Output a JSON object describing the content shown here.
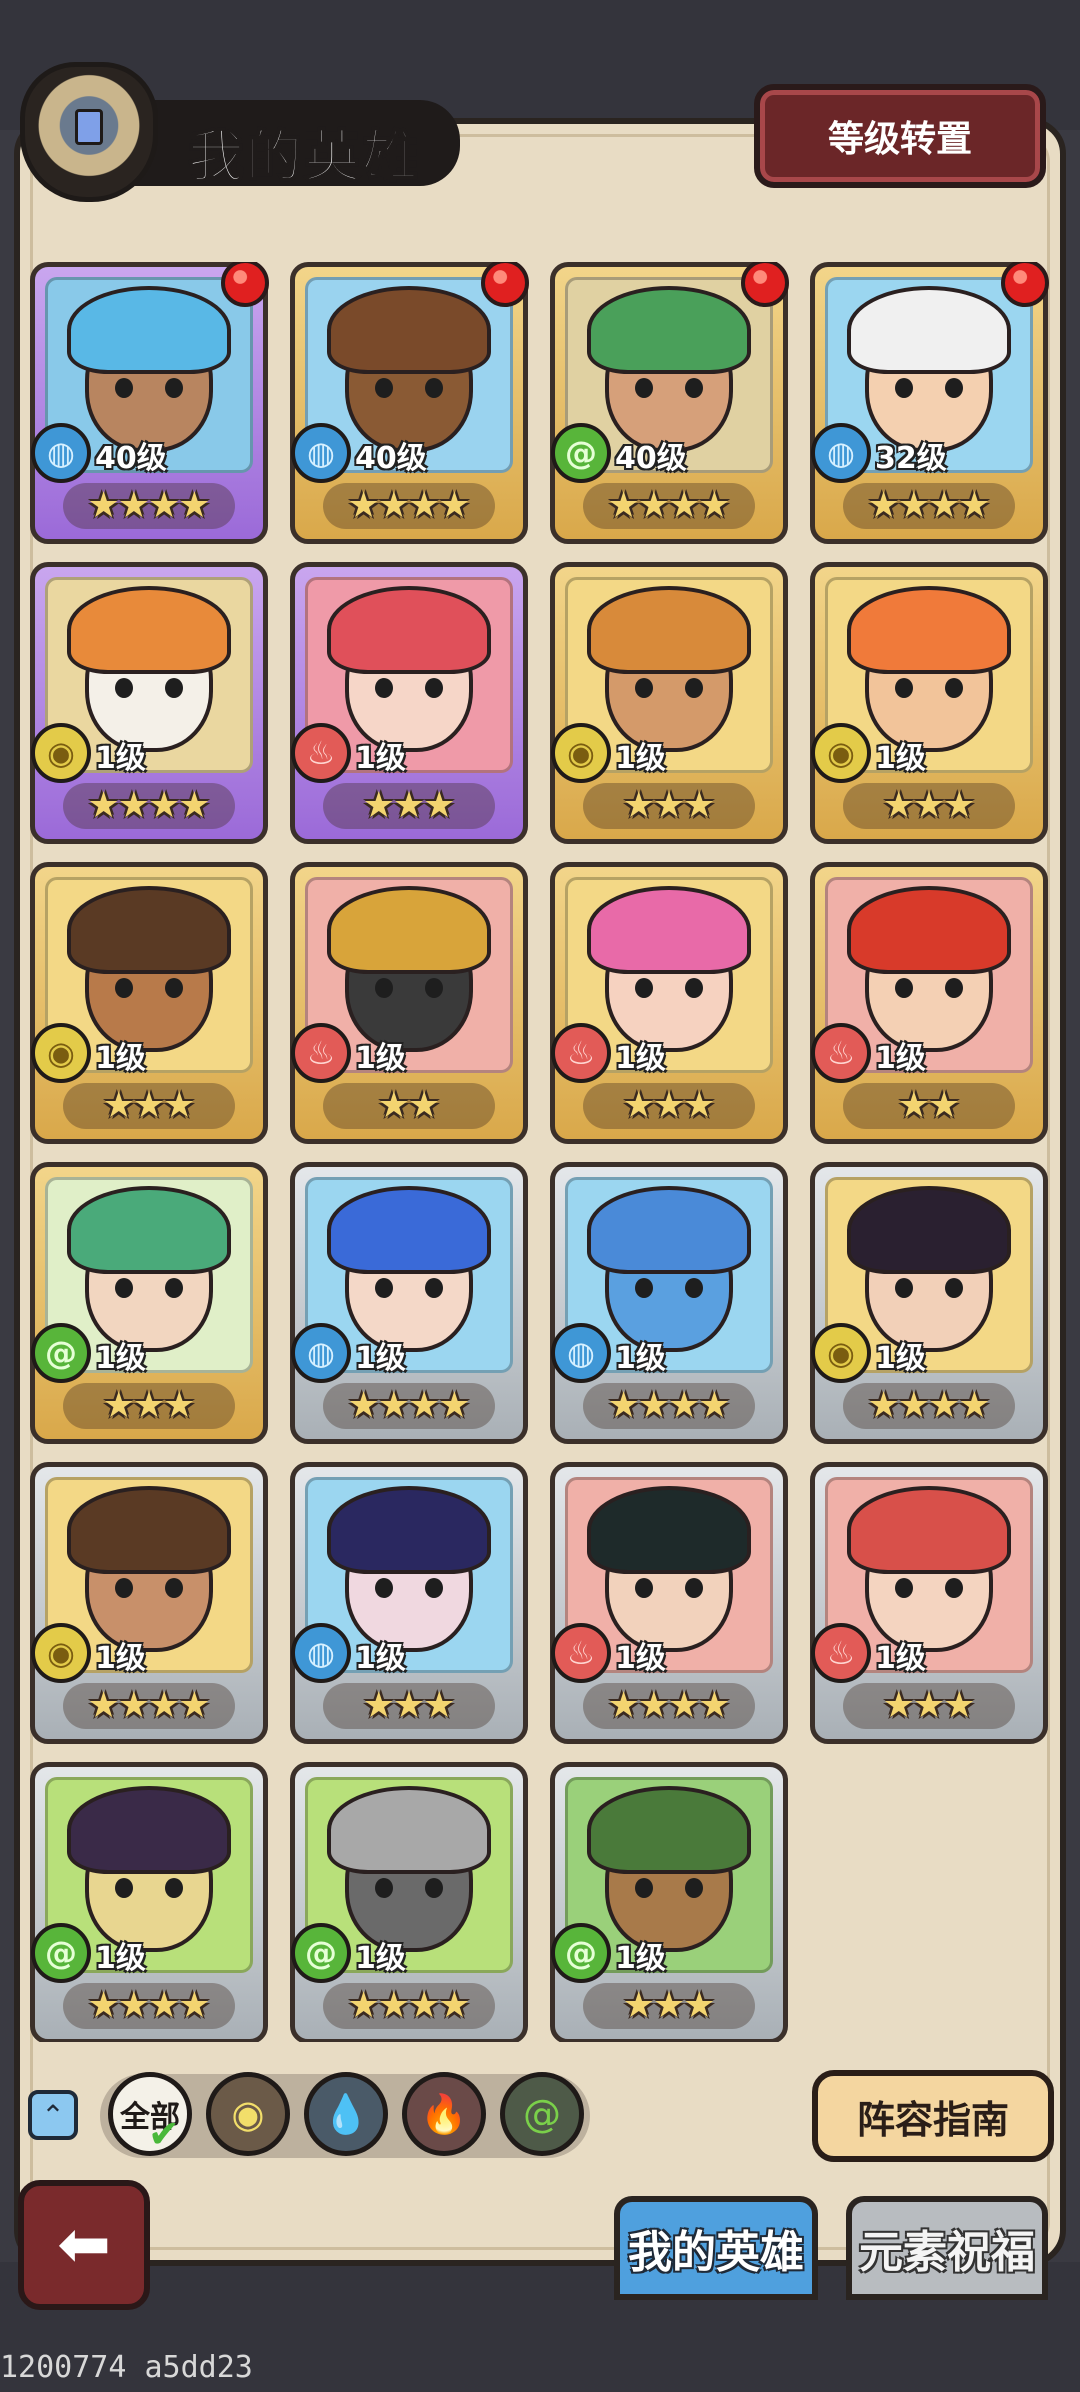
{
  "header": {
    "title": "我的英雄",
    "level_transfer_label": "等级转置"
  },
  "heroes": [
    {
      "level": "40级",
      "stars": 4,
      "element": "water",
      "frame": "purple",
      "dot": true,
      "hair": "#59b8e6",
      "skin": "#b88560",
      "bg": "#89c9e9"
    },
    {
      "level": "40级",
      "stars": 4,
      "element": "water",
      "frame": "gold",
      "dot": true,
      "hair": "#7a4a2a",
      "skin": "#8a5a34",
      "bg": "#9ad3ef"
    },
    {
      "level": "40级",
      "stars": 4,
      "element": "wind",
      "frame": "gold",
      "dot": true,
      "hair": "#4aa05a",
      "skin": "#d6a07a",
      "bg": "#e0d1a2"
    },
    {
      "level": "32级",
      "stars": 4,
      "element": "water",
      "frame": "gold",
      "dot": true,
      "hair": "#f0f0f0",
      "skin": "#f4d0b0",
      "bg": "#9bd6f0"
    },
    {
      "level": "1级",
      "stars": 4,
      "element": "earth",
      "frame": "purple",
      "dot": false,
      "hair": "#e88a3a",
      "skin": "#f4f0e8",
      "bg": "#ead7a0"
    },
    {
      "level": "1级",
      "stars": 3,
      "element": "fire",
      "frame": "purple",
      "dot": false,
      "hair": "#e0505a",
      "skin": "#f6d6c8",
      "bg": "#ef9aa8"
    },
    {
      "level": "1级",
      "stars": 3,
      "element": "earth",
      "frame": "gold",
      "dot": false,
      "hair": "#d88a3a",
      "skin": "#d49a6a",
      "bg": "#f3d886"
    },
    {
      "level": "1级",
      "stars": 3,
      "element": "earth",
      "frame": "gold",
      "dot": false,
      "hair": "#f07a3a",
      "skin": "#f2c49a",
      "bg": "#f3d886"
    },
    {
      "level": "1级",
      "stars": 3,
      "element": "earth",
      "frame": "gold",
      "dot": false,
      "hair": "#5a3a24",
      "skin": "#b87a4a",
      "bg": "#f3d886"
    },
    {
      "level": "1级",
      "stars": 2,
      "element": "fire",
      "frame": "gold",
      "dot": false,
      "hair": "#d8a43a",
      "skin": "#3a3a3a",
      "bg": "#f0b0a8"
    },
    {
      "level": "1级",
      "stars": 3,
      "element": "fire",
      "frame": "gold",
      "dot": false,
      "hair": "#e86aa8",
      "skin": "#f6d2c0",
      "bg": "#f3d886"
    },
    {
      "level": "1级",
      "stars": 2,
      "element": "fire",
      "frame": "gold",
      "dot": false,
      "hair": "#d83a2a",
      "skin": "#f4d0b4",
      "bg": "#f0b0a8"
    },
    {
      "level": "1级",
      "stars": 3,
      "element": "wind",
      "frame": "gold",
      "dot": false,
      "hair": "#4aaa7a",
      "skin": "#f2d6c0",
      "bg": "#e0efc8"
    },
    {
      "level": "1级",
      "stars": 4,
      "element": "water",
      "frame": "silver",
      "dot": false,
      "hair": "#3a6ad8",
      "skin": "#f4d8c8",
      "bg": "#9bd6f0"
    },
    {
      "level": "1级",
      "stars": 4,
      "element": "water",
      "frame": "silver",
      "dot": false,
      "hair": "#4a8ad8",
      "skin": "#5aa0e0",
      "bg": "#9bd6f0"
    },
    {
      "level": "1级",
      "stars": 4,
      "element": "earth",
      "frame": "silver",
      "dot": false,
      "hair": "#2a2030",
      "skin": "#f2d0b8",
      "bg": "#f3d886"
    },
    {
      "level": "1级",
      "stars": 4,
      "element": "earth",
      "frame": "silver",
      "dot": false,
      "hair": "#5a3a24",
      "skin": "#c8906a",
      "bg": "#f3d886"
    },
    {
      "level": "1级",
      "stars": 3,
      "element": "water",
      "frame": "silver",
      "dot": false,
      "hair": "#2a2860",
      "skin": "#f0d8e0",
      "bg": "#9bd6f0"
    },
    {
      "level": "1级",
      "stars": 4,
      "element": "fire",
      "frame": "silver",
      "dot": false,
      "hair": "#1e2a2a",
      "skin": "#f2d2bc",
      "bg": "#f0b0a8"
    },
    {
      "level": "1级",
      "stars": 3,
      "element": "fire",
      "frame": "silver",
      "dot": false,
      "hair": "#d8504a",
      "skin": "#f4d4c0",
      "bg": "#f0b0a8"
    },
    {
      "level": "1级",
      "stars": 4,
      "element": "wind",
      "frame": "silver",
      "dot": false,
      "hair": "#3a2a48",
      "skin": "#e8d690",
      "bg": "#b8e07a"
    },
    {
      "level": "1级",
      "stars": 4,
      "element": "wind",
      "frame": "silver",
      "dot": false,
      "hair": "#a8a8a8",
      "skin": "#6a6a6a",
      "bg": "#b8e07a"
    },
    {
      "level": "1级",
      "stars": 3,
      "element": "wind",
      "frame": "silver",
      "dot": false,
      "hair": "#4a7a3a",
      "skin": "#a87a4a",
      "bg": "#9ad07a"
    }
  ],
  "filter": {
    "all_label": "全部",
    "chips": [
      {
        "name": "earth",
        "glyph": "◉"
      },
      {
        "name": "water",
        "glyph": "💧"
      },
      {
        "name": "fire",
        "glyph": "🔥"
      },
      {
        "name": "wind",
        "glyph": "@"
      }
    ],
    "guide_label": "阵容指南"
  },
  "tabs": {
    "my_heroes": "我的英雄",
    "element_blessing": "元素祝福"
  },
  "build_id": "1200774 a5dd23"
}
